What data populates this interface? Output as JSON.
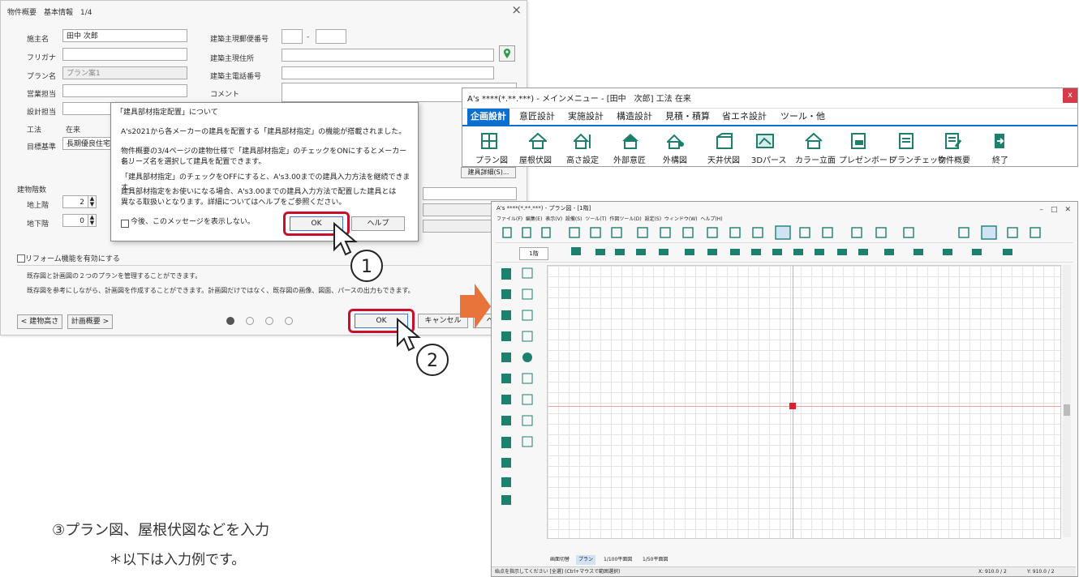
{
  "dialog": {
    "title": "物件概要　基本情報　1/4",
    "close": "×",
    "fields": {
      "owner_label": "施主名",
      "owner_value": "田中 次郎",
      "kana_label": "フリガナ",
      "plan_label": "プラン名",
      "plan_value": "プラン案1",
      "sales_label": "営業担当",
      "design_label": "設計担当",
      "method_label": "工法",
      "method_value": "在来",
      "target_label": "目標基準",
      "target_value": "長期優良住宅",
      "zip_label": "建築主現郵便番号",
      "zip_sep": "-",
      "addr_label": "建築主現住所",
      "tel_label": "建築主電話番号",
      "comment_label": "コメント"
    },
    "floors_label": "建物階数",
    "above_label": "地上階",
    "above_value": "2",
    "below_label": "地下階",
    "below_value": "0",
    "reform_label": "リフォーム機能を有効にする",
    "reform_desc1": "既存図と計画図の２つのプランを管理することができます。",
    "reform_desc2": "既存図を参考にしながら、計画図を作成することができます。計画図だけではなく、既存図の画像、図面、パースの出力もできます。",
    "partial_btn": "建具詳細(S)...",
    "back_btn": "< 建物高さ",
    "next_btn": "計画概要 >",
    "ok": "OK",
    "cancel": "キャンセル",
    "help": "ヘルプ"
  },
  "popup": {
    "title": "「建具部材指定配置」について",
    "p1": "A's2021から各メーカーの建具を配置する「建具部材指定」の機能が搭載されました。",
    "p2a": "物件概要の3/4ページの建物仕様で「建具部材指定」のチェックをONにするとメーカー名、",
    "p2b": "シリーズ名を選択して建具を配置できます。",
    "p3": "「建具部材指定」のチェックをOFFにすると、A's3.00までの建具入力方法を継続できます。",
    "p4a": "建具部材指定をお使いになる場合、A's3.00までの建具入力方法で配置した建具とは",
    "p4b": "異なる取扱いとなります。詳細についてはヘルプをご参照ください。",
    "checkbox": "今後、このメッセージを表示しない。",
    "ok": "OK",
    "help": "ヘルプ"
  },
  "steps": {
    "one": "1",
    "two": "2",
    "three": "③プラン図、屋根伏図などを入力",
    "note": "＊以下は入力例です。"
  },
  "menu": {
    "title": "A's ****(*.**.***) - メインメニュー - [田中　次郎] 工法 在来",
    "close": "x",
    "tabs": [
      "企画設計",
      "意匠設計",
      "実施設計",
      "構造設計",
      "見積・積算",
      "省エネ設計",
      "ツール・他"
    ],
    "items": [
      "プラン図",
      "屋根伏図",
      "高さ設定",
      "外部意匠",
      "外構図",
      "天井伏図",
      "3Dパース",
      "カラー立面",
      "プレゼンボード",
      "プランチェック",
      "物件概要",
      "終了"
    ]
  },
  "cad": {
    "title": "A's ****(*.**.***) - プラン図 - [1階]",
    "menubar": [
      "ファイル(F)",
      "編集(E)",
      "表示(V)",
      "設備(S)",
      "ツール(T)",
      "作図ツール(D)",
      "設定(S)",
      "ウィンドウ(W)",
      "ヘルプ(H)"
    ],
    "floor": "1階",
    "status": "始点を指示してください [全選] (Ctrl+マウスで範囲選択)",
    "coord_x": "X: 910.0 / 2",
    "coord_y": "Y: 910.0 / 2",
    "bottom_tabs": [
      "画面切替",
      "プラン",
      "1/100平面図",
      "1/50平面図"
    ]
  },
  "colors": {
    "accent": "#0a6fcf",
    "ring": "#c8102e",
    "arrow": "#e8743b",
    "origin": "#e11d2a"
  }
}
